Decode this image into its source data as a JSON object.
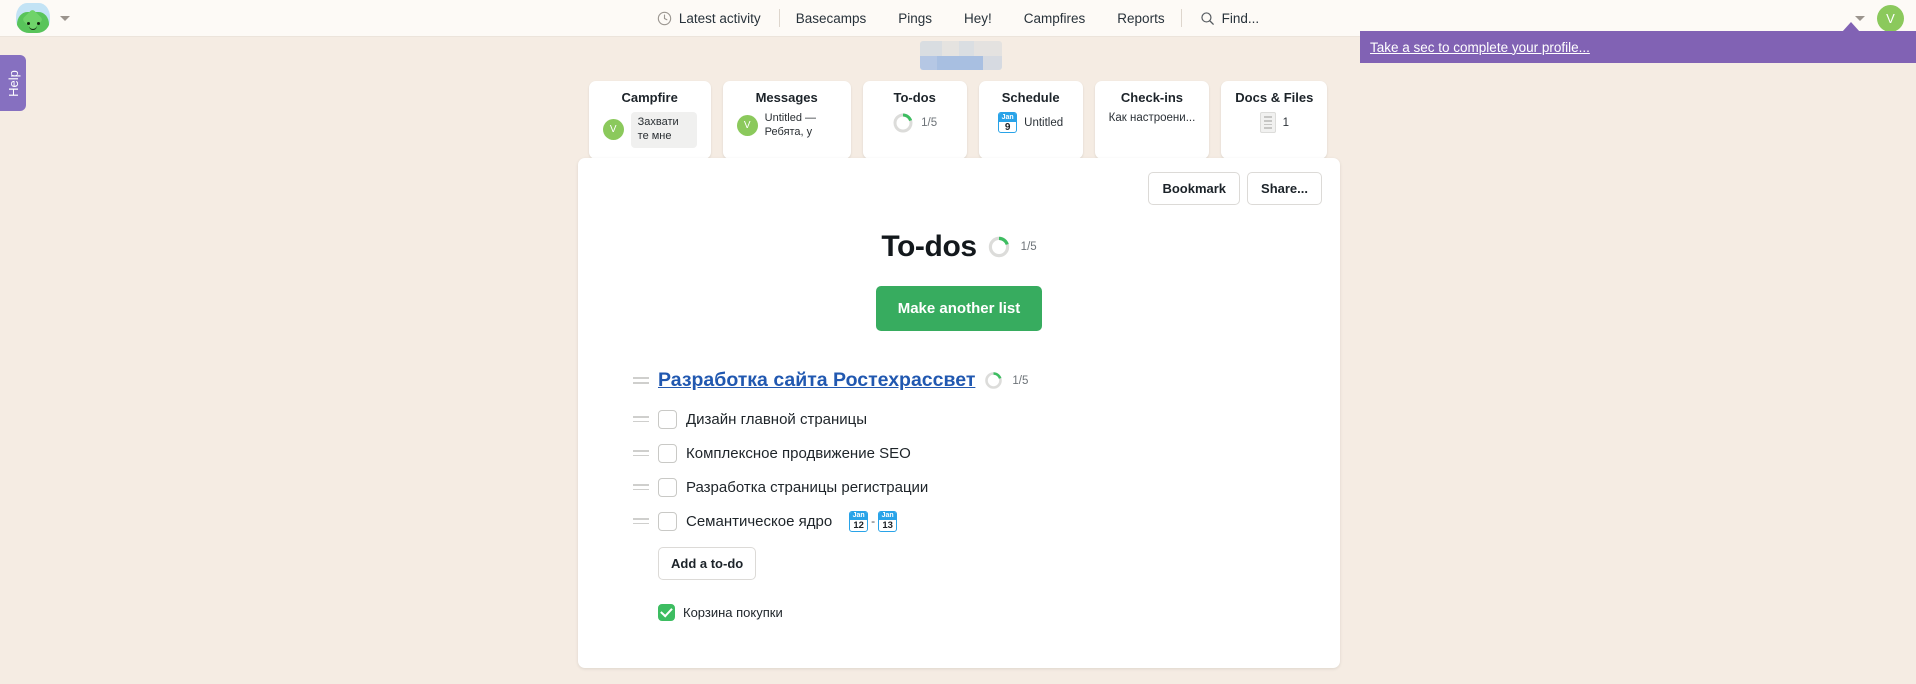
{
  "topbar": {
    "logo_icon": "basecamp-logo-icon",
    "logo_caret_icon": "chevron-down-icon",
    "latest_activity": {
      "icon": "clock-icon",
      "label": "Latest activity"
    },
    "nav_items": [
      {
        "label": "Basecamps"
      },
      {
        "label": "Pings"
      },
      {
        "label": "Hey!"
      },
      {
        "label": "Campfires"
      },
      {
        "label": "Reports"
      }
    ],
    "find": {
      "icon": "search-icon",
      "label": "Find..."
    },
    "account_caret_icon": "chevron-down-icon",
    "avatar_initial": "V",
    "avatar_color": "#8bc95c"
  },
  "profile_tooltip": {
    "text": "Take a sec to complete your profile...",
    "background": "#8162b4"
  },
  "help_tab": {
    "label": "Help",
    "background": "#8670c0"
  },
  "tool_cards": [
    {
      "title": "Campfire",
      "avatar_initial": "V",
      "snippet": "Захвати те мне",
      "style": "bubble"
    },
    {
      "title": "Messages",
      "avatar_initial": "V",
      "snippet": "Untitled — Ребята, у",
      "style": "plain"
    },
    {
      "title": "To-dos",
      "ratio": "1/5",
      "progress_percent": 20,
      "style": "donut"
    },
    {
      "title": "Schedule",
      "calendar": {
        "month": "Jan",
        "day": "9"
      },
      "subtitle": "Untitled",
      "style": "calendar"
    },
    {
      "title": "Check-ins",
      "subtitle": "Как настроени...",
      "style": "text"
    },
    {
      "title": "Docs & Files",
      "count": "1",
      "doc_icon": "document-icon",
      "style": "doc"
    }
  ],
  "panel": {
    "bookmark_label": "Bookmark",
    "share_label": "Share...",
    "page_title": "To-dos",
    "page_ratio": "1/5",
    "page_progress_percent": 20,
    "make_list_label": "Make another list",
    "list": {
      "title": "Разработка сайта Ростехрассвет",
      "ratio": "1/5",
      "progress_percent": 20,
      "items": [
        {
          "label": "Дизайн главной страницы",
          "done": false
        },
        {
          "label": "Комплексное продвижение SEO",
          "done": false
        },
        {
          "label": "Разработка страницы регистрации",
          "done": false
        },
        {
          "label": "Семантическое ядро",
          "done": false,
          "date_start": {
            "month": "Jan",
            "day": "12"
          },
          "date_end": {
            "month": "Jan",
            "day": "13"
          },
          "date_separator": "-"
        }
      ],
      "add_todo_label": "Add a to-do",
      "completed": [
        {
          "label": "Корзина покупки",
          "done": true
        }
      ]
    }
  },
  "colors": {
    "page_background": "#f5ece3",
    "topbar_background": "#fdfaf6",
    "accent_green": "#37ac5f",
    "link_blue": "#2158b0",
    "calendar_blue": "#29a3e8",
    "purple": "#8162b4"
  }
}
